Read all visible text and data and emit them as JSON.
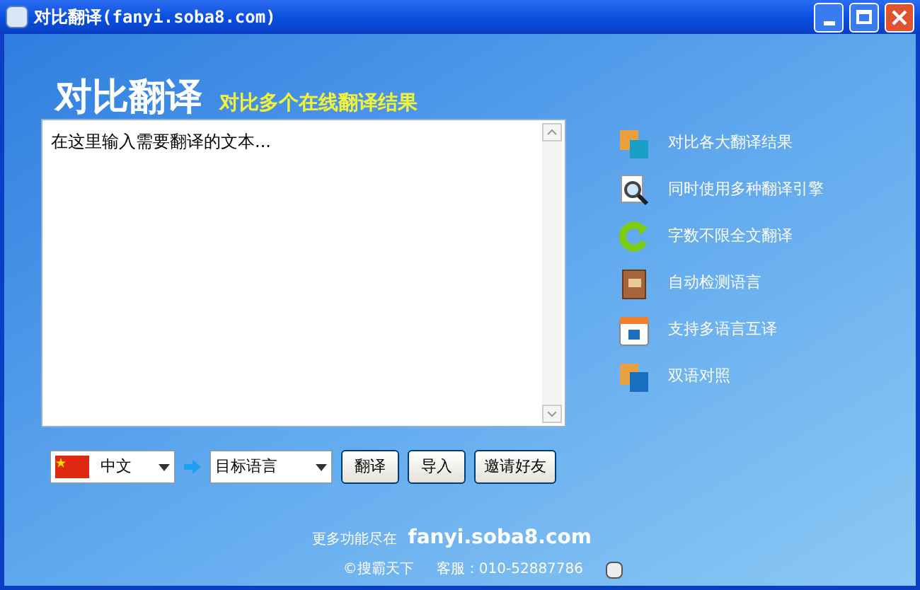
{
  "window": {
    "title": "对比翻译(fanyi.soba8.com)"
  },
  "header": {
    "logo": "对比翻译",
    "tagline": "对比多个在线翻译结果"
  },
  "input": {
    "value": "在这里输入需要翻译的文本..."
  },
  "features": [
    {
      "label": "对比各大翻译结果"
    },
    {
      "label": "同时使用多种翻译引擎"
    },
    {
      "label": "字数不限全文翻译"
    },
    {
      "label": "自动检测语言"
    },
    {
      "label": "支持多语言互译"
    },
    {
      "label": "双语对照"
    }
  ],
  "source_language": {
    "value": "中文"
  },
  "target_language": {
    "value": "目标语言"
  },
  "buttons": [
    "翻译",
    "导入",
    "邀请好友"
  ],
  "footer": {
    "more": "更多功能尽在",
    "site": "fanyi.soba8.com",
    "copyright": "©搜霸天下",
    "support": "客服：010-52887786"
  }
}
